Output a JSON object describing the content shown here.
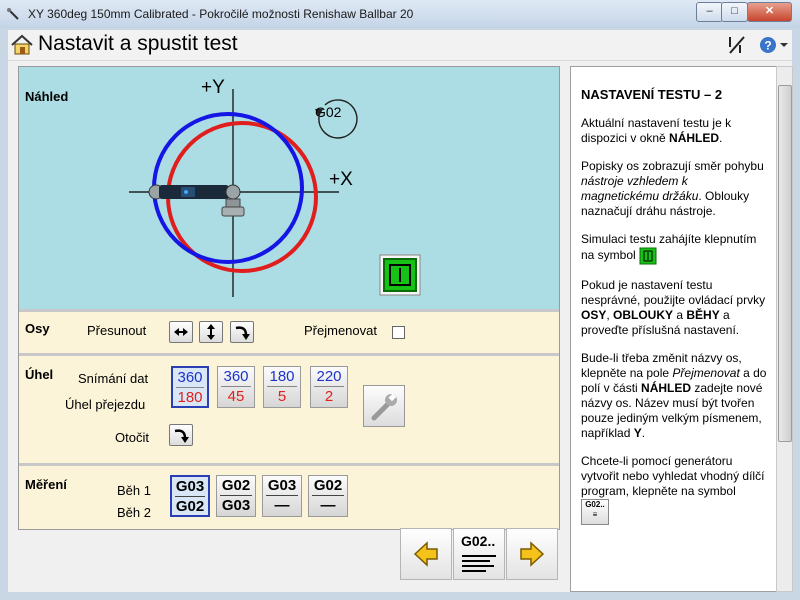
{
  "window": {
    "title": "XY 360deg 150mm Calibrated - Pokročilé možnosti Renishaw Ballbar 20",
    "min": "–",
    "max": "□",
    "close": "✕"
  },
  "header": {
    "title": "Nastavit a spustit test"
  },
  "preview": {
    "label": "Náhled",
    "axis_y": "+Y",
    "axis_x": "+X",
    "direction": "G02",
    "colors": {
      "blue": "#1515e6",
      "red": "#e01e1e"
    }
  },
  "osy": {
    "label": "Osy",
    "move_label": "Přesunout",
    "rename_label": "Přejmenovat",
    "rename_checked": false
  },
  "uhel": {
    "label": "Úhel",
    "capture_label": "Snímání dat",
    "overrun_label": "Úhel přejezdu",
    "rotate_label": "Otočit",
    "tiles": [
      {
        "capture": "360",
        "overrun": "180",
        "selected": true
      },
      {
        "capture": "360",
        "overrun": "45",
        "selected": false
      },
      {
        "capture": "180",
        "overrun": "5",
        "selected": false
      },
      {
        "capture": "220",
        "overrun": "2",
        "selected": false
      }
    ]
  },
  "mereni": {
    "label": "Měření",
    "run1": "Běh 1",
    "run2": "Běh 2",
    "tiles": [
      {
        "run1": "G03",
        "run2": "G02",
        "selected": true
      },
      {
        "run1": "G02",
        "run2": "G03",
        "selected": false
      },
      {
        "run1": "G03",
        "run2": "—",
        "selected": false
      },
      {
        "run1": "G02",
        "run2": "—",
        "selected": false
      }
    ]
  },
  "nav": {
    "program": "G02.."
  },
  "help": {
    "heading": "NASTAVENÍ TESTU – 2",
    "p1_a": "Aktuální nastavení testu je k dispozici v okně ",
    "p1_b": "NÁHLED",
    "p1_c": ".",
    "p2_a": "Popisky os zobrazují směr pohybu ",
    "p2_b": "nástroje vzhledem k magnetickému držáku",
    "p2_c": ". Oblouky naznačují dráhu nástroje.",
    "p3_a": "Simulaci testu zahájíte klepnutím na symbol",
    "p4_a": "Pokud je nastavení testu nesprávné, použijte ovládací prvky ",
    "p4_b": "OSY",
    "p4_c": ", ",
    "p4_d": "OBLOUKY",
    "p4_e": " a ",
    "p4_f": "BĚHY",
    "p4_g": " a proveďte příslušná nastavení.",
    "p5_a": "Bude-li třeba změnit názvy os, klepněte na pole ",
    "p5_b": "Přejmenovat",
    "p5_c": " a do polí v části ",
    "p5_d": "NÁHLED",
    "p5_e": " zadejte nové názvy os. Název musí být tvořen pouze jediným velkým písmenem, například ",
    "p5_f": "Y",
    "p5_g": ".",
    "p6_a": "Chcete-li pomocí generátoru vytvořit nebo vyhledat vhodný dílčí program, klepněte na symbol",
    "icon_label": "G02.."
  }
}
